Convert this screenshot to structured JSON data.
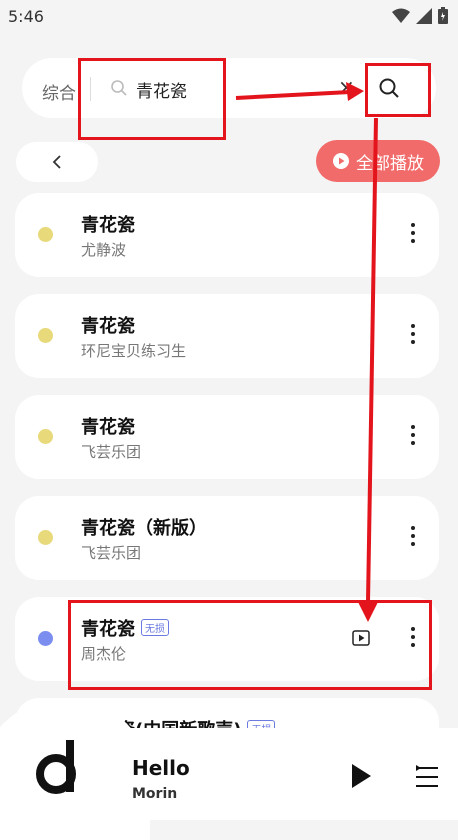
{
  "status_bar": {
    "time": "5:46"
  },
  "search": {
    "tab": "综合",
    "query": "青花瓷",
    "clear": "×"
  },
  "actions": {
    "play_all": "全部播放"
  },
  "songs": [
    {
      "title": "青花瓷",
      "artist": "尤静波",
      "dot_color": "#e8d97a"
    },
    {
      "title": "青花瓷",
      "artist": "环尼宝贝练习生",
      "dot_color": "#e8d97a"
    },
    {
      "title": "青花瓷",
      "artist": "飞芸乐团",
      "dot_color": "#e8d97a"
    },
    {
      "title": "青花瓷（新版）",
      "artist": "飞芸乐团",
      "dot_color": "#e8d97a"
    },
    {
      "title": "青花瓷",
      "artist": "周杰伦",
      "badge": "无损",
      "dot_color": "#7b8ef0",
      "has_mv": true
    },
    {
      "title": "青花瓷(中国新歌声)",
      "artist": "",
      "badge": "无损",
      "dot_color": "#e8d97a"
    }
  ],
  "player": {
    "title": "Hello",
    "artist": "Morin"
  },
  "colors": {
    "accent": "#f26b6b",
    "highlight": "#e3141c",
    "badge": "#6b7ae0"
  }
}
